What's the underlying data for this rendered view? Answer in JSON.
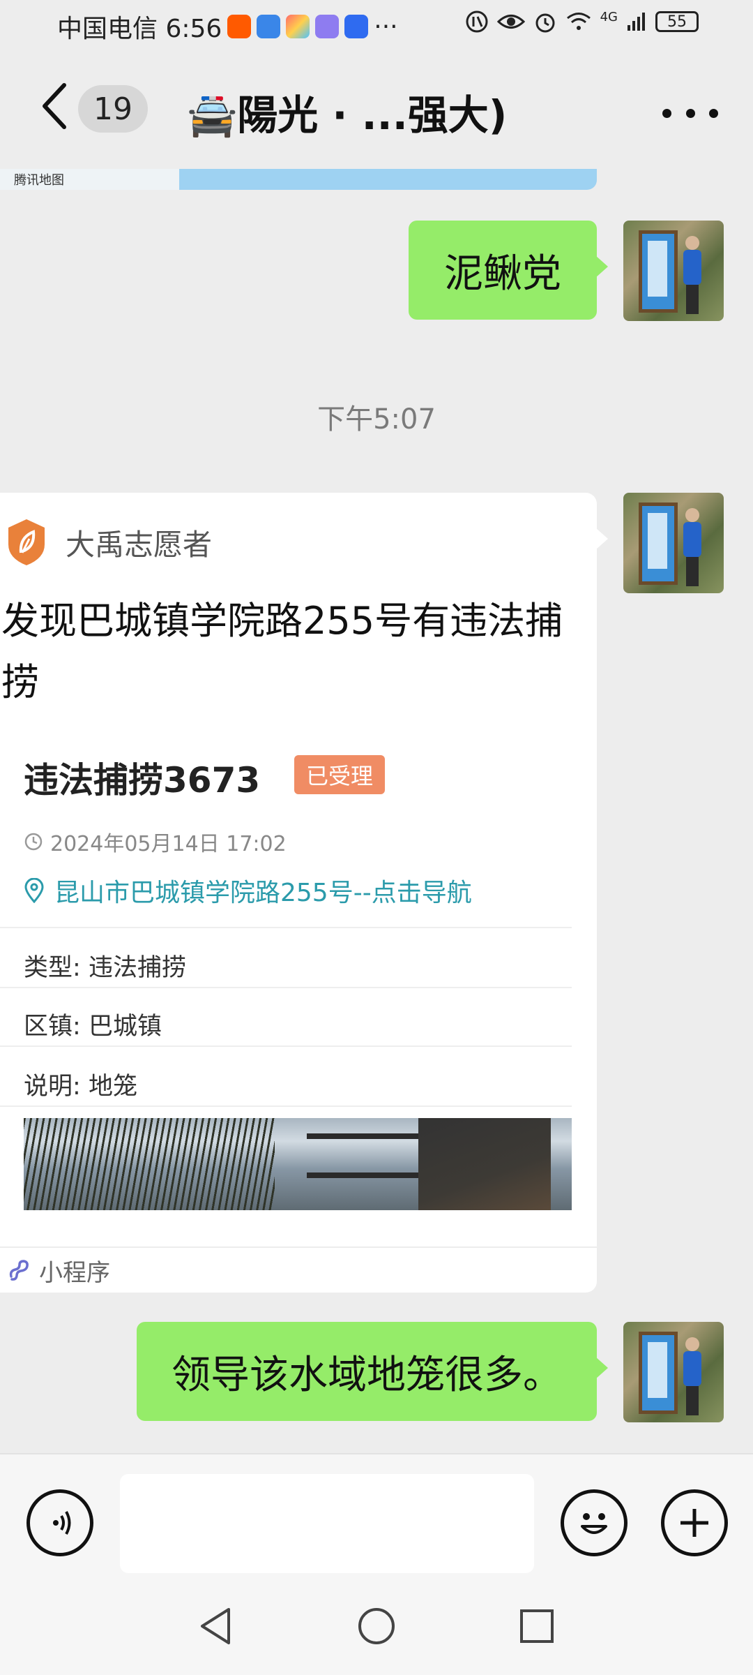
{
  "status_bar": {
    "carrier_time": "中国电信 6:56",
    "more_dots": "···",
    "network": "4G",
    "battery": "55"
  },
  "header": {
    "unread_count": "19",
    "chat_title": "🚔陽光 · ...强大)"
  },
  "map_preview": {
    "label": "腾讯地图"
  },
  "messages": {
    "msg1_text": "泥鳅党",
    "time_divider": "下午5:07",
    "msg3_text": "领导该水域地笼很多。"
  },
  "card": {
    "source_name": "大禹志愿者",
    "title": "发现巴城镇学院路255号有违法捕捞",
    "case_title": "违法捕捞3673",
    "status_tag": "已受理",
    "datetime": "2024年05月14日 17:02",
    "location": "昆山市巴城镇学院路255号--点击导航",
    "rows": [
      {
        "key": "类型:",
        "value": "违法捕捞"
      },
      {
        "key": "区镇:",
        "value": "巴城镇"
      },
      {
        "key": "说明:",
        "value": "地笼"
      }
    ],
    "footer_label": "小程序"
  },
  "colors": {
    "bubble_green": "#95ec69",
    "status_tag": "#f08c64",
    "location_link": "#2b9bab",
    "background": "#ededed"
  }
}
